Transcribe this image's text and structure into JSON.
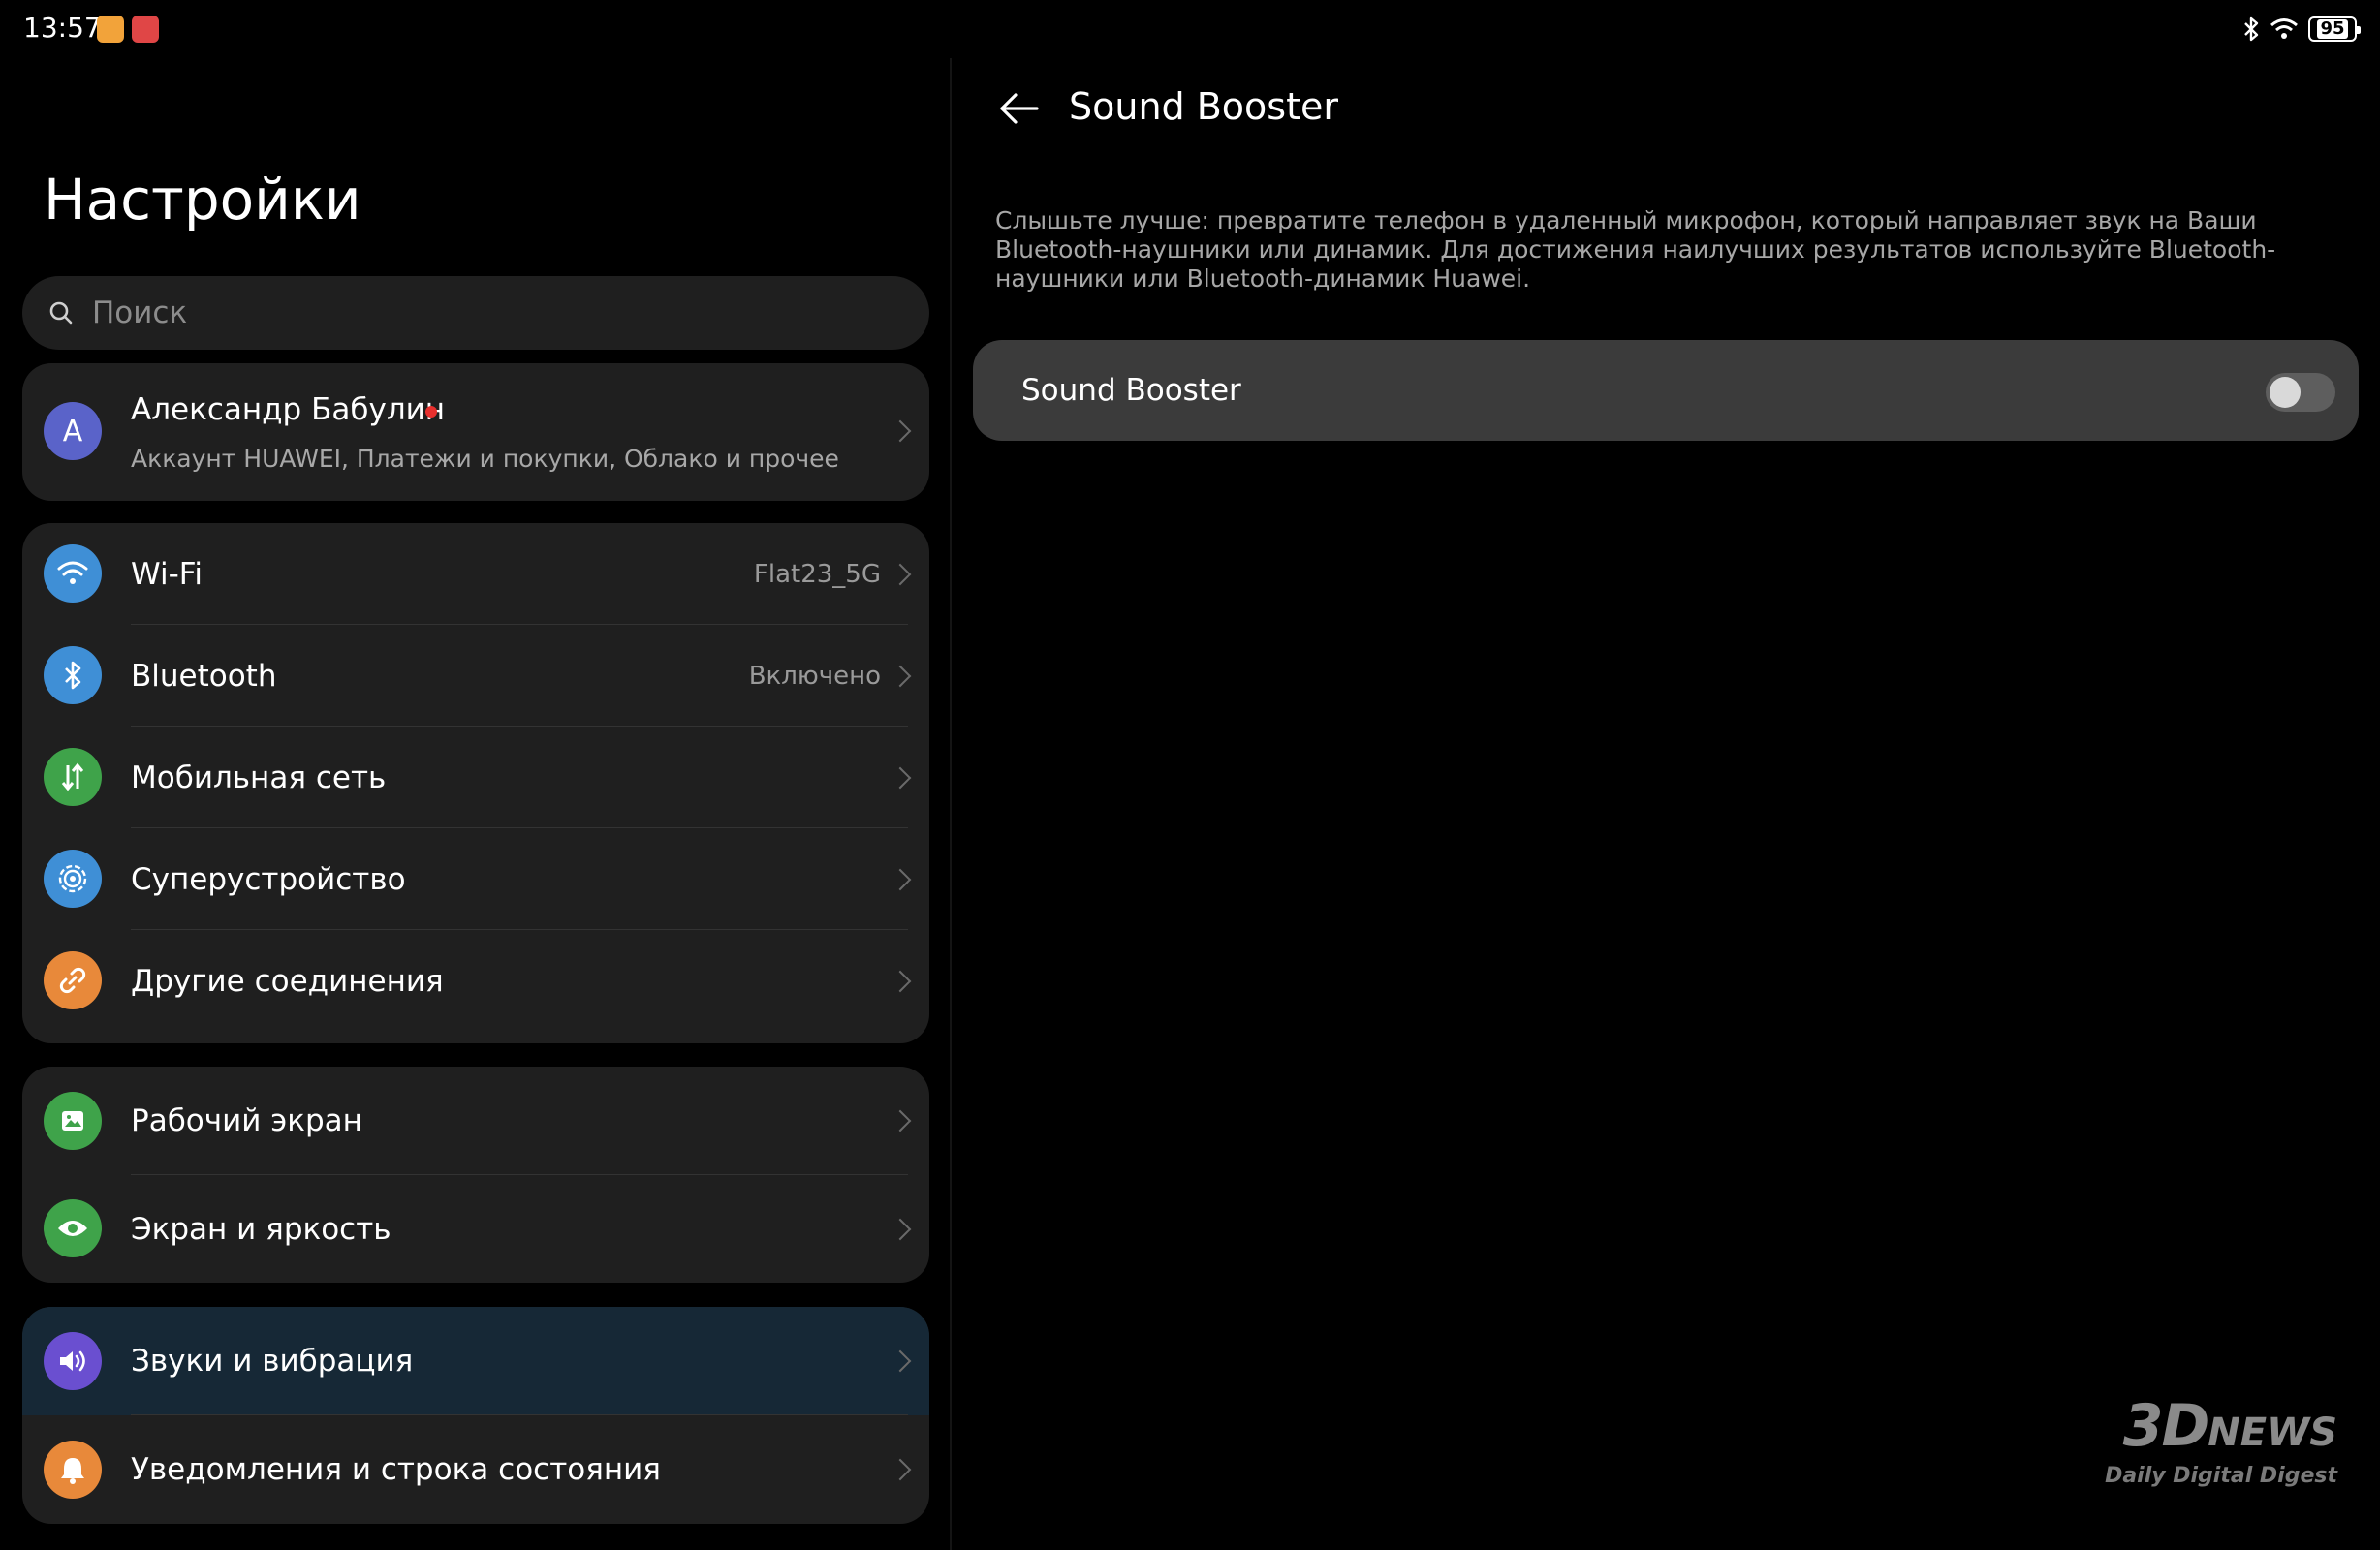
{
  "status_bar": {
    "time": "13:57",
    "battery": "95"
  },
  "left": {
    "title": "Настройки",
    "search_placeholder": "Поиск",
    "account": {
      "initial": "А",
      "name": "Александр Бабулин",
      "subtitle": "Аккаунт HUAWEI, Платежи и покупки, Облако и прочее"
    },
    "connectivity": [
      {
        "label": "Wi-Fi",
        "value": "Flat23_5G",
        "icon": "wifi-icon",
        "color": "#3f8fd6"
      },
      {
        "label": "Bluetooth",
        "value": "Включено",
        "icon": "bluetooth-icon",
        "color": "#3f8fd6"
      },
      {
        "label": "Мобильная сеть",
        "value": "",
        "icon": "mobile-data-icon",
        "color": "#3fa34a"
      },
      {
        "label": "Суперустройство",
        "value": "",
        "icon": "super-device-icon",
        "color": "#3f8fd6"
      },
      {
        "label": "Другие соединения",
        "value": "",
        "icon": "link-icon",
        "color": "#e8893a"
      }
    ],
    "display": [
      {
        "label": "Рабочий экран",
        "icon": "home-screen-icon",
        "color": "#3fa34a"
      },
      {
        "label": "Экран и яркость",
        "icon": "eye-icon",
        "color": "#3fa34a"
      }
    ],
    "sound": [
      {
        "label": "Звуки и вибрация",
        "icon": "speaker-icon",
        "color": "#6a4fd0"
      },
      {
        "label": "Уведомления и строка состояния",
        "icon": "bell-icon",
        "color": "#e8893a"
      }
    ]
  },
  "right": {
    "title": "Sound Booster",
    "description": "Слышьте лучше: превратите телефон в удаленный микрофон, который направляет звук на Ваши Bluetooth-наушники или динамик. Для достижения наилучших результатов используйте Bluetooth-наушники или Bluetooth-динамик Huawei.",
    "toggle_label": "Sound Booster",
    "toggle_on": false
  },
  "watermark": {
    "logo_3d": "3D",
    "logo_news": "NEWS",
    "tagline": "Daily Digital Digest"
  }
}
